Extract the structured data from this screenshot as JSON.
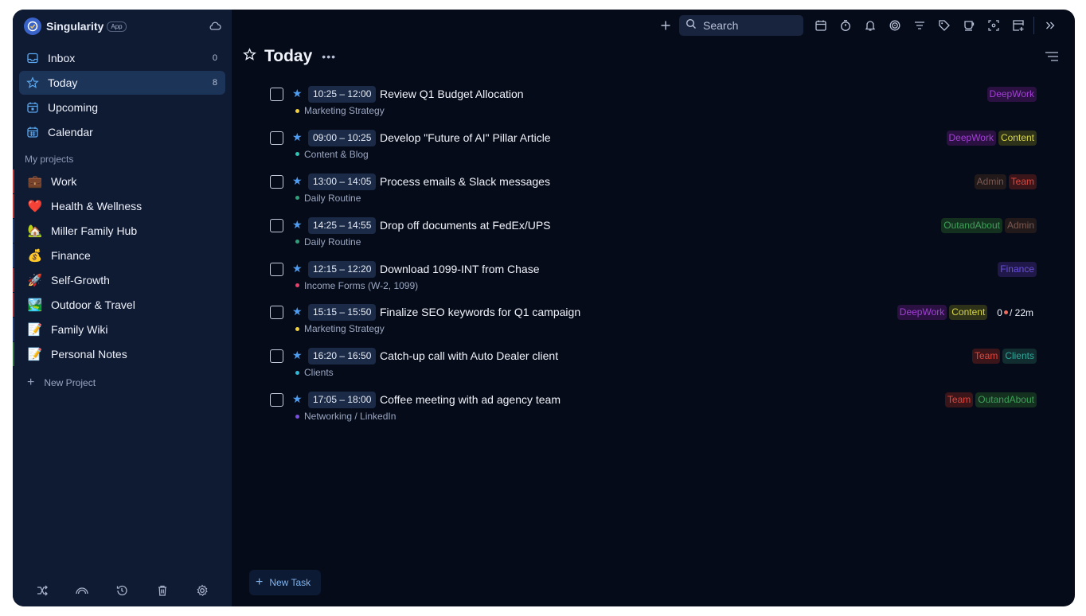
{
  "app": {
    "name": "Singularity",
    "badge": "App"
  },
  "nav": [
    {
      "label": "Inbox",
      "count": "0",
      "icon": "inbox-icon"
    },
    {
      "label": "Today",
      "count": "8",
      "icon": "star-icon"
    },
    {
      "label": "Upcoming",
      "count": "",
      "icon": "calendar-icon"
    },
    {
      "label": "Calendar",
      "count": "",
      "icon": "calendar-grid-icon"
    }
  ],
  "projects_label": "My projects",
  "projects": [
    {
      "label": "Work",
      "emoji": "💼",
      "color": "#b8332f"
    },
    {
      "label": "Health & Wellness",
      "emoji": "❤️",
      "color": "#b8332f"
    },
    {
      "label": "Miller Family Hub",
      "emoji": "🏡",
      "color": "#1f3a6e"
    },
    {
      "label": "Finance",
      "emoji": "💰",
      "color": "#1f3a6e"
    },
    {
      "label": "Self-Growth",
      "emoji": "🚀",
      "color": "#9a2b32"
    },
    {
      "label": "Outdoor & Travel",
      "emoji": "🏞️",
      "color": "#9a2b32"
    },
    {
      "label": "Family Wiki",
      "emoji": "📝",
      "color": "#1f3a6e"
    },
    {
      "label": "Personal Notes",
      "emoji": "📝",
      "color": "#2c6e3a"
    }
  ],
  "new_project_label": "New Project",
  "search": {
    "placeholder": "Search"
  },
  "page": {
    "title": "Today"
  },
  "new_task_label": "New Task",
  "tasks": [
    {
      "time": "10:25 – 12:00",
      "title": "Review Q1 Budget Allocation",
      "project": "Marketing Strategy",
      "dot": "#f2d03b",
      "tags": [
        {
          "label": "DeepWork",
          "color": "#a33fd6",
          "bg": "#2a1142"
        }
      ]
    },
    {
      "time": "09:00 – 10:25",
      "title": "Develop \"Future of AI\" Pillar Article",
      "project": "Content & Blog",
      "dot": "#2fc3b3",
      "tags": [
        {
          "label": "DeepWork",
          "color": "#a33fd6",
          "bg": "#2a1142"
        },
        {
          "label": "Content",
          "color": "#d8d64a",
          "bg": "#2d3219"
        }
      ]
    },
    {
      "time": "13:00 – 14:05",
      "title": "Process emails & Slack messages",
      "project": "Daily Routine",
      "dot": "#2fa07a",
      "tags": [
        {
          "label": "Admin",
          "color": "#7a5a52",
          "bg": "#22191b"
        },
        {
          "label": "Team",
          "color": "#e0473e",
          "bg": "#3a1519"
        }
      ]
    },
    {
      "time": "14:25 – 14:55",
      "title": "Drop off documents at FedEx/UPS",
      "project": "Daily Routine",
      "dot": "#2fa07a",
      "tags": [
        {
          "label": "OutandAbout",
          "color": "#3fa05a",
          "bg": "#14301f"
        },
        {
          "label": "Admin",
          "color": "#7a5a52",
          "bg": "#22191b"
        }
      ]
    },
    {
      "time": "12:15 – 12:20",
      "title": "Download 1099-INT from Chase",
      "project": "Income Forms (W-2, 1099)",
      "dot": "#e8406a",
      "tags": [
        {
          "label": "Finance",
          "color": "#6a4fe0",
          "bg": "#1f1848"
        }
      ]
    },
    {
      "time": "15:15 – 15:50",
      "title": "Finalize SEO keywords for Q1 campaign",
      "project": "Marketing Strategy",
      "dot": "#f2d03b",
      "tags": [
        {
          "label": "DeepWork",
          "color": "#a33fd6",
          "bg": "#2a1142"
        },
        {
          "label": "Content",
          "color": "#d8d64a",
          "bg": "#2d3219"
        }
      ],
      "timer": {
        "count": "0",
        "duration": "/ 22m"
      }
    },
    {
      "time": "16:20 – 16:50",
      "title": "Catch-up call with Auto Dealer client",
      "project": "Clients",
      "dot": "#2fb9d6",
      "tags": [
        {
          "label": "Team",
          "color": "#e0473e",
          "bg": "#3a1519"
        },
        {
          "label": "Clients",
          "color": "#2fa89a",
          "bg": "#112d30"
        }
      ]
    },
    {
      "time": "17:05 – 18:00",
      "title": "Coffee meeting with ad agency team",
      "project": "Networking / LinkedIn",
      "dot": "#7a4fe0",
      "tags": [
        {
          "label": "Team",
          "color": "#e0473e",
          "bg": "#3a1519"
        },
        {
          "label": "OutandAbout",
          "color": "#3fa05a",
          "bg": "#14301f"
        }
      ]
    }
  ]
}
